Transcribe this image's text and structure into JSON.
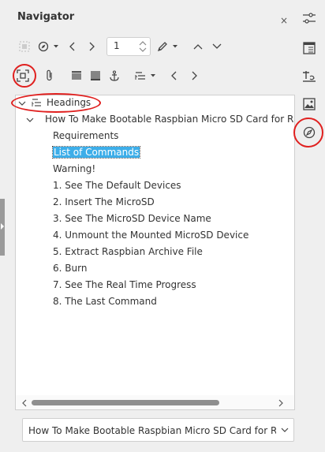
{
  "panel": {
    "title": "Navigator",
    "close_glyph": "×"
  },
  "toolbar1": {
    "page_value": "1",
    "icons": [
      "toggle-icon",
      "navigate-by-icon",
      "previous-icon",
      "next-icon",
      "drag-mode-icon",
      "promote-up-icon",
      "demote-down-icon"
    ]
  },
  "toolbar2": {
    "icons": [
      "content-navigation-view-icon",
      "reminder-icon",
      "header-icon",
      "footer-icon",
      "anchor-icon",
      "heading-levels-icon",
      "promote-chapter-icon",
      "demote-chapter-icon"
    ]
  },
  "tree": {
    "category": "Headings",
    "document_heading": "How To Make Bootable Raspbian Micro SD Card for Ras",
    "items": [
      "Requirements",
      "List of Commands",
      "Warning!",
      "1. See The Default Devices",
      "2. Insert The MicroSD",
      "3. See The MicroSD Device Name",
      "4. Unmount the Mounted MicroSD Device",
      "5. Extract Raspbian Archive File",
      "6. Burn",
      "7. See The Real Time Progress",
      "8. The Last Command"
    ],
    "selected_index": 1
  },
  "document_select": {
    "value": "How To Make Bootable Raspbian Micro SD Card for Raspb"
  },
  "sidebar_deck": {
    "icons": [
      "properties-icon",
      "page-icon",
      "styles-icon",
      "gallery-icon",
      "navigator-icon"
    ]
  },
  "colors": {
    "selection": "#3daee9",
    "annotation_red": "#e0201f"
  }
}
